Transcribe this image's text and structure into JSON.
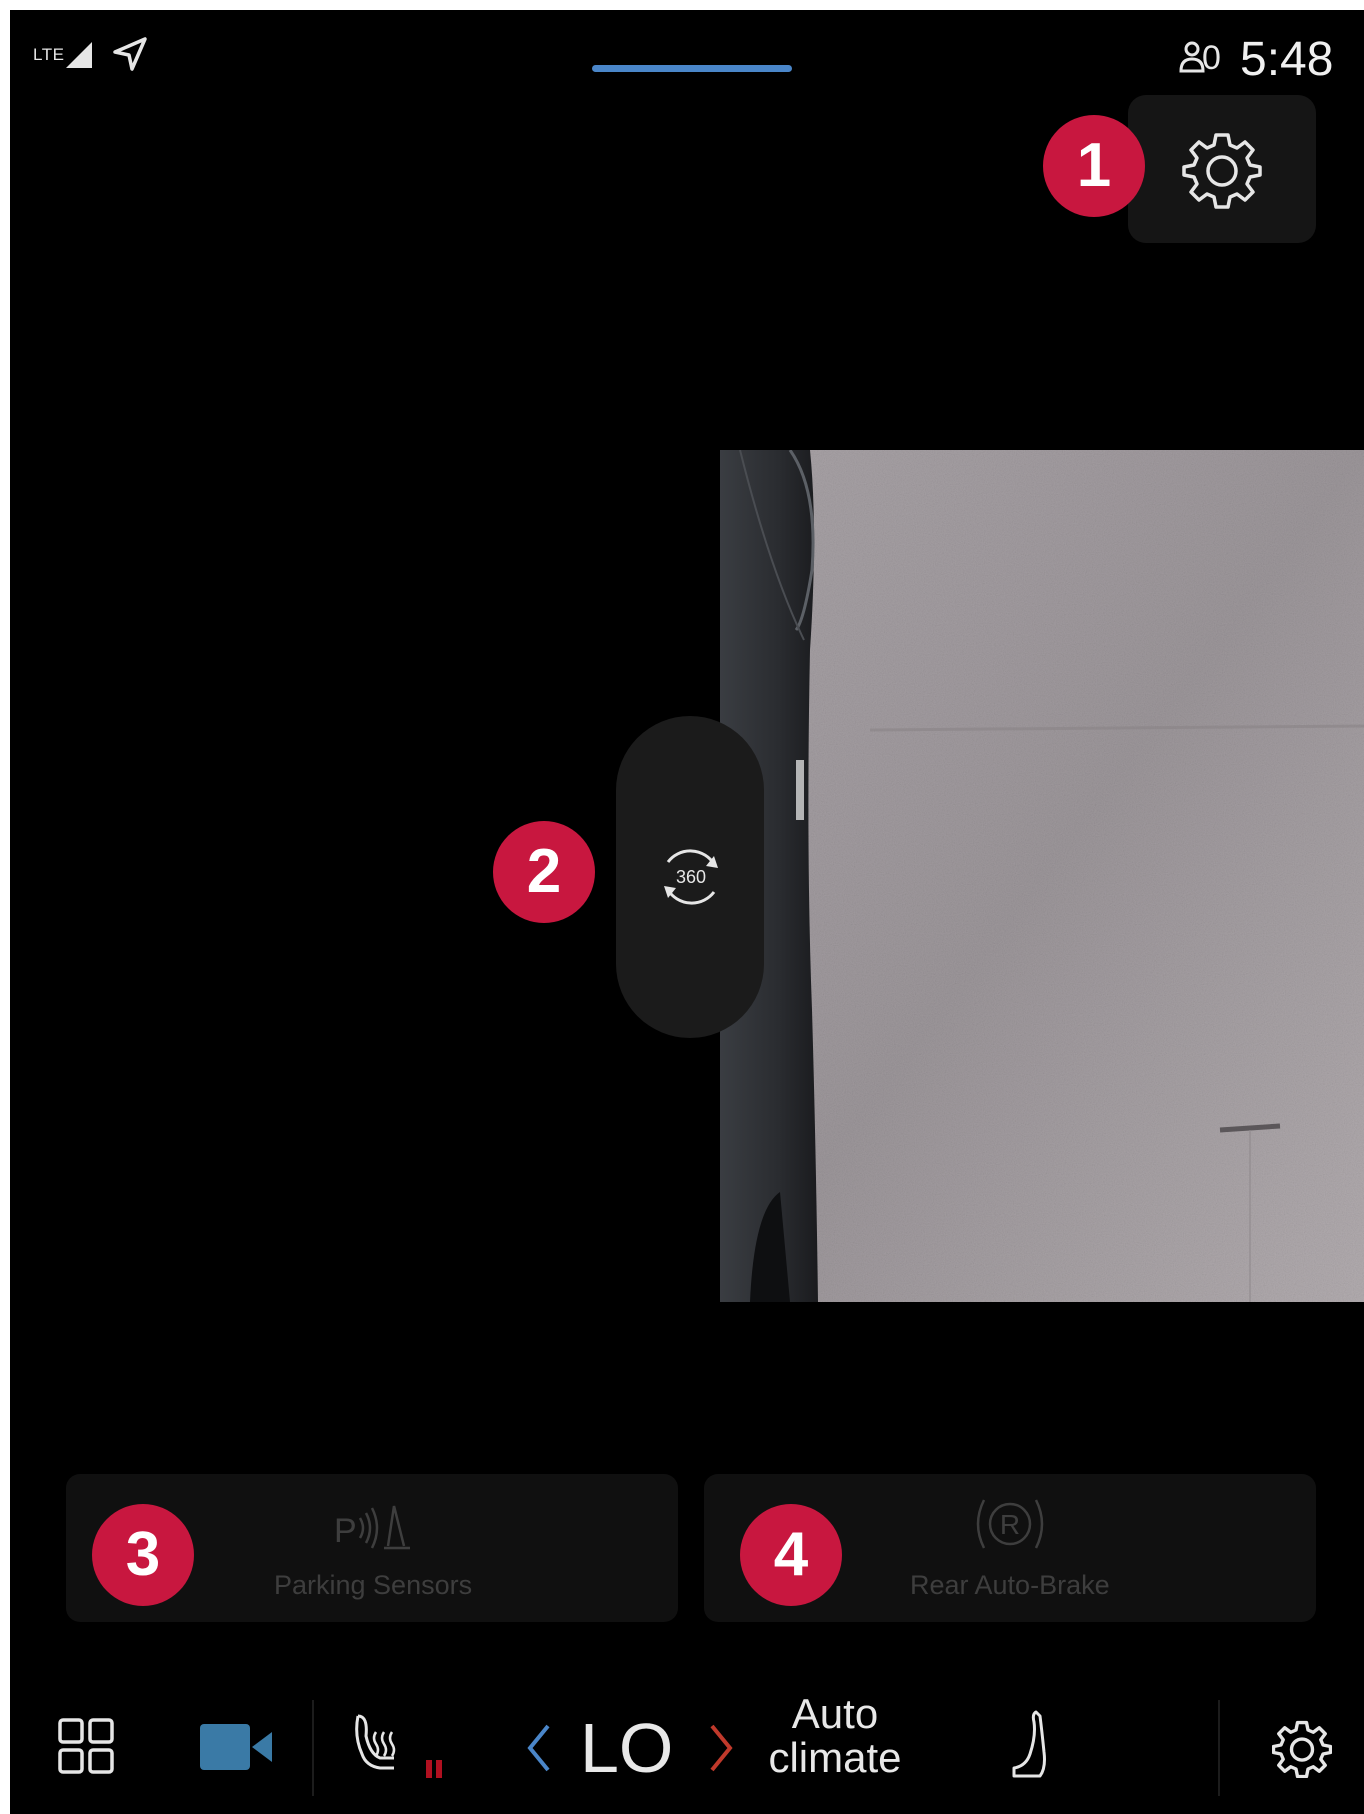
{
  "status_bar": {
    "network": "LTE",
    "profile_count": "0",
    "time": "5:48"
  },
  "callouts": {
    "one": "1",
    "two": "2",
    "three": "3",
    "four": "4"
  },
  "camera": {
    "rotate_label": "360"
  },
  "cards": {
    "parking_sensors": {
      "icon_text": "P",
      "label": "Parking Sensors"
    },
    "rear_auto_brake": {
      "icon_text": "R",
      "label": "Rear Auto-Brake"
    }
  },
  "climate": {
    "temperature": "LO",
    "mode_line1": "Auto",
    "mode_line2": "climate"
  },
  "colors": {
    "accent_blue": "#4a86c9",
    "callout_red": "#c8173f",
    "camera_app_blue": "#3a7aa6",
    "heat_red": "#b01020"
  },
  "icons": [
    "signal-icon",
    "navigation-arrow-icon",
    "profile-icon",
    "gear-icon",
    "360-rotate-icon",
    "parking-sensors-icon",
    "rear-auto-brake-icon",
    "app-grid-icon",
    "camera-icon",
    "seat-heat-icon",
    "chevron-left-icon",
    "chevron-right-icon",
    "seat-icon"
  ]
}
